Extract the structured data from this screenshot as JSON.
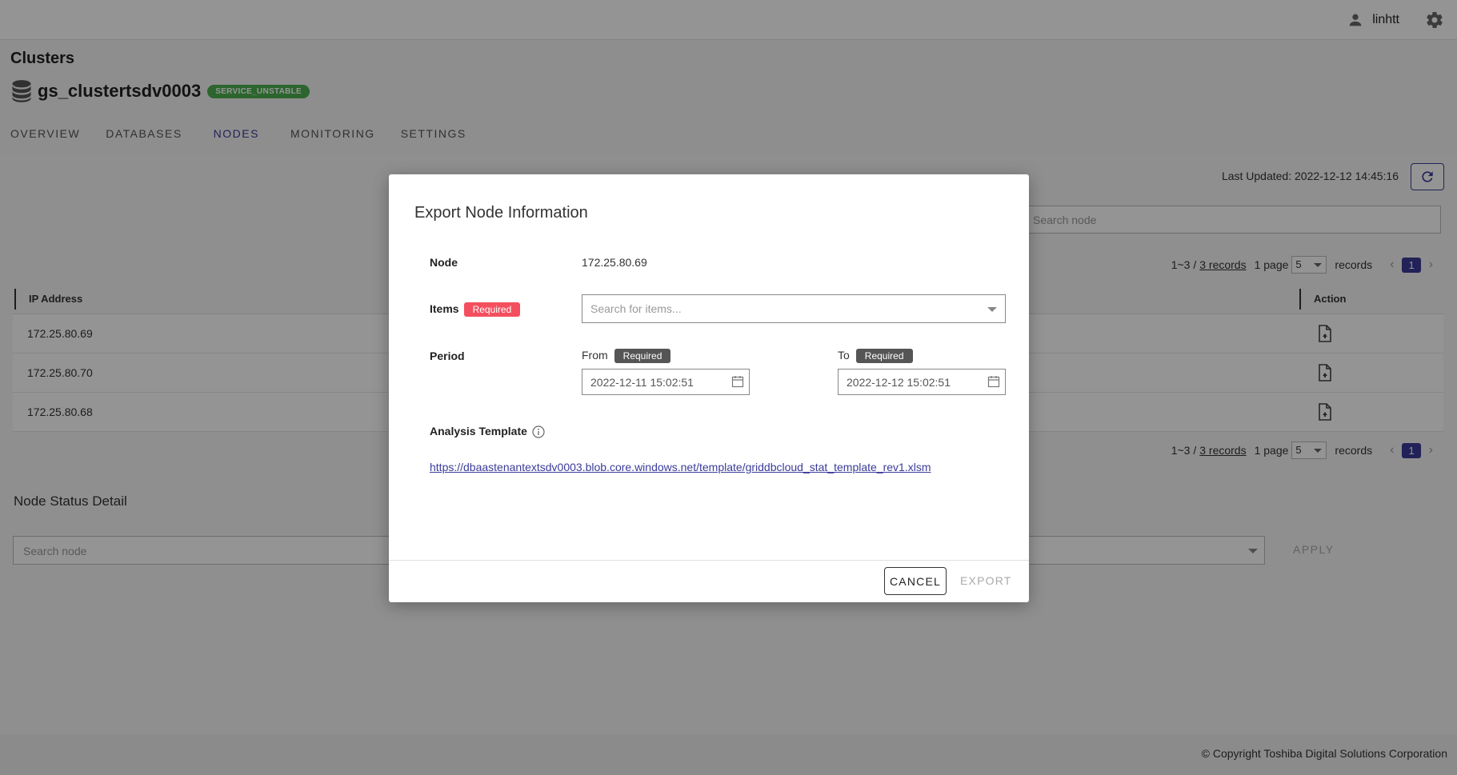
{
  "topbar": {
    "username": "linhtt"
  },
  "header": {
    "page_title": "Clusters",
    "cluster_name": "gs_clustertsdv0003",
    "status_badge": "SERVICE_UNSTABLE",
    "tabs": [
      {
        "label": "OVERVIEW"
      },
      {
        "label": "DATABASES"
      },
      {
        "label": "NODES"
      },
      {
        "label": "MONITORING"
      },
      {
        "label": "SETTINGS"
      }
    ],
    "active_tab": "NODES"
  },
  "nodes": {
    "last_updated": "Last Updated: 2022-12-12 14:45:16",
    "search_placeholder": "Search node",
    "pagination": {
      "range": "1~3 /",
      "records_link": "3 records",
      "page_label": "1 page",
      "page_size": "5",
      "records_label": "records",
      "current_page": "1"
    },
    "columns": {
      "ip": "IP Address",
      "action": "Action"
    },
    "rows": [
      {
        "ip": "172.25.80.69"
      },
      {
        "ip": "172.25.80.70"
      },
      {
        "ip": "172.25.80.68"
      }
    ]
  },
  "node_status": {
    "title": "Node Status Detail",
    "search_placeholder": "Search node",
    "apply_label": "APPLY"
  },
  "footer": {
    "copyright": "© Copyright Toshiba Digital Solutions Corporation"
  },
  "modal": {
    "title": "Export Node Information",
    "node_label": "Node",
    "node_value": "172.25.80.69",
    "items_label": "Items",
    "required": "Required",
    "items_placeholder": "Search for items...",
    "period_label": "Period",
    "from_label": "From",
    "from_value": "2022-12-11 15:02:51",
    "to_label": "To",
    "to_value": "2022-12-12 15:02:51",
    "template_label": "Analysis Template",
    "template_url": "https://dbaastenantextsdv0003.blob.core.windows.net/template/griddbcloud_stat_template_rev1.xlsm",
    "cancel_label": "CANCEL",
    "export_label": "EXPORT"
  },
  "colors": {
    "accent": "#3b3b9a",
    "status_badge": "#4caf50",
    "required_red": "#f44f5e",
    "required_dark": "#555555"
  }
}
